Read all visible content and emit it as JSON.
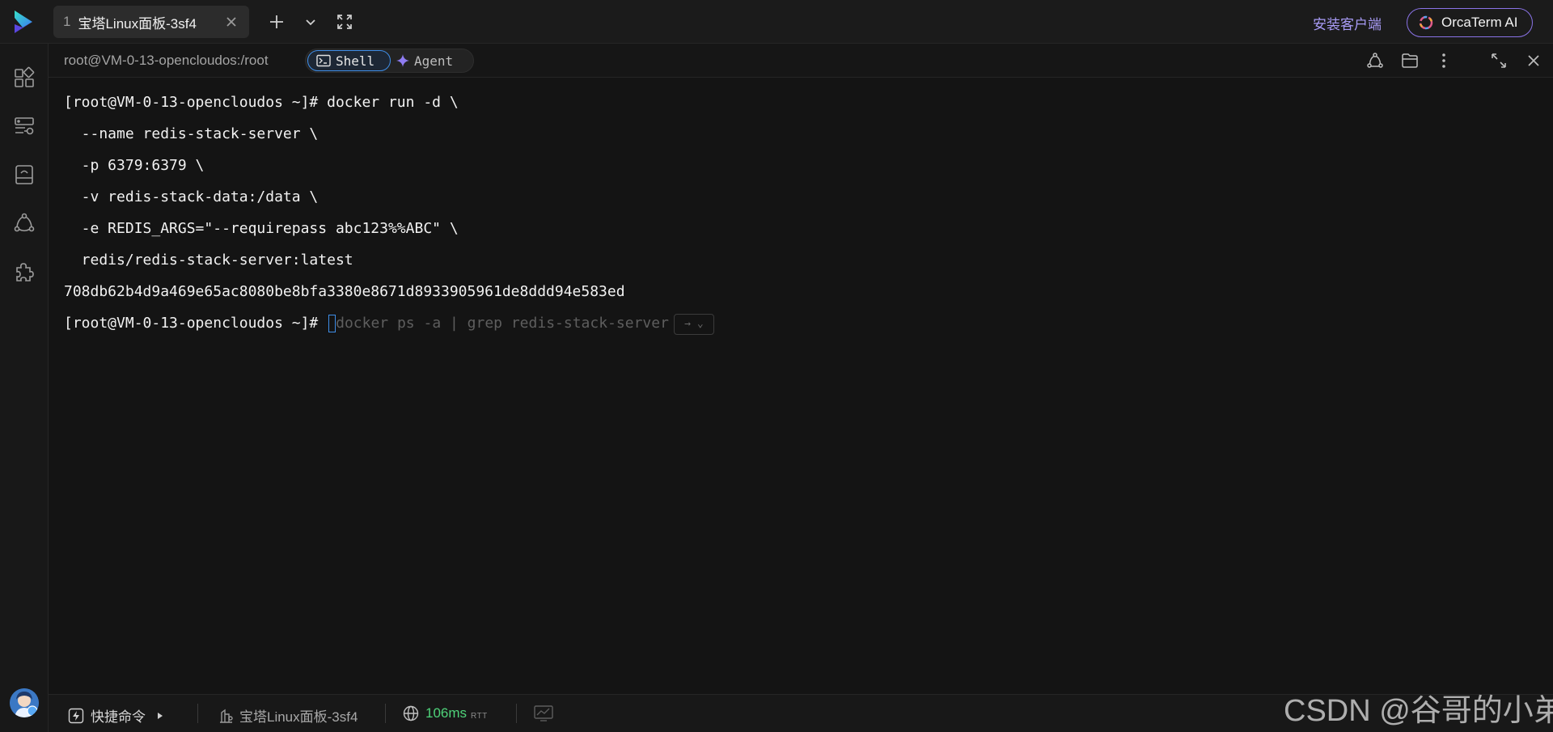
{
  "topbar": {
    "tab": {
      "index": "1",
      "title": "宝塔Linux面板-3sf4"
    },
    "install_client": "安装客户端",
    "ai_button": "OrcaTerm AI",
    "icons": [
      "app-logo-icon",
      "close-icon",
      "plus-icon",
      "chevron-down-icon",
      "fullscreen-icon",
      "orcaterm-ai-icon"
    ]
  },
  "sidebar": {
    "items": [
      "dashboard-icon",
      "server-list-icon",
      "storage-icon",
      "network-icon",
      "extension-icon"
    ]
  },
  "session": {
    "path": "root@VM-0-13-opencloudos:/root",
    "modes": {
      "shell": "Shell",
      "agent": "Agent",
      "active": "Shell"
    },
    "icons": [
      "share-icon",
      "folder-icon",
      "more-icon",
      "expand-icon",
      "close-icon"
    ]
  },
  "terminal": {
    "lines": [
      "[root@VM-0-13-opencloudos ~]# docker run -d \\",
      "  --name redis-stack-server \\",
      "  -p 6379:6379 \\",
      "  -v redis-stack-data:/data \\",
      "  -e REDIS_ARGS=\"--requirepass abc123%%ABC\" \\",
      "  redis/redis-stack-server:latest",
      "708db62b4d9a469e65ac8080be8bfa3380e8671d8933905961de8ddd94e583ed"
    ],
    "prompt": "[root@VM-0-13-opencloudos ~]# ",
    "suggestion": "docker ps -a | grep redis-stack-server",
    "accept_hint": "→ ⌄"
  },
  "statusbar": {
    "quick_commands": "快捷命令",
    "server_name": "宝塔Linux面板-3sf4",
    "latency": "106ms",
    "latency_unit": "RTT"
  },
  "watermark": "CSDN @谷哥的小弟",
  "colors": {
    "accent_blue": "#3f8ee8",
    "accent_purple": "#8a73e6",
    "latency_green": "#4fd37a",
    "background": "#141414"
  }
}
